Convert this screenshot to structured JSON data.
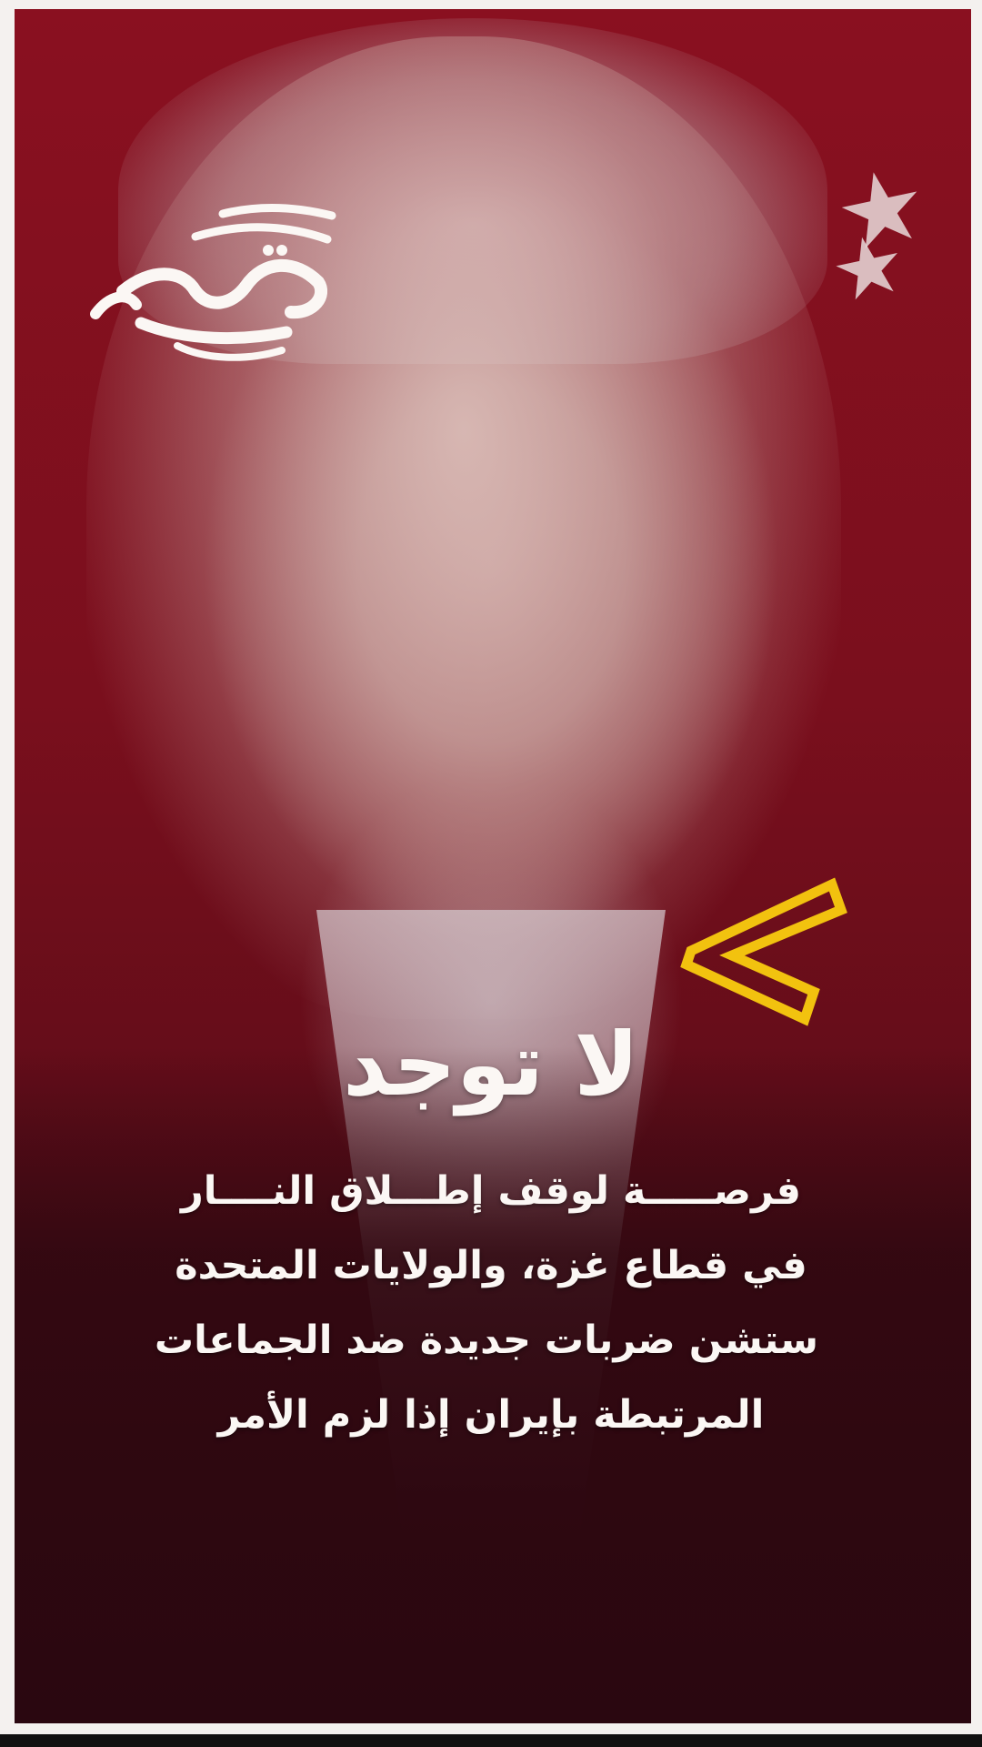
{
  "logo": {
    "text": "مصدر نيوز",
    "icon": "brand-calligraphy-logo"
  },
  "decor": {
    "icon": "yellow-chevron-icon",
    "accent": "#f2c20f"
  },
  "headline": "لا توجد",
  "body_lines": [
    "فرصـــــة لوقف إطـــلاق النــــار",
    "في قطاع غزة، والولايات المتحدة",
    "ستشن ضربات جديدة ضد الجماعات",
    "المرتبطة بإيران إذا لزم الأمر"
  ],
  "colors": {
    "background": "#7a0f1d",
    "text": "#fbf7f4",
    "border": "#f4f1ef"
  }
}
